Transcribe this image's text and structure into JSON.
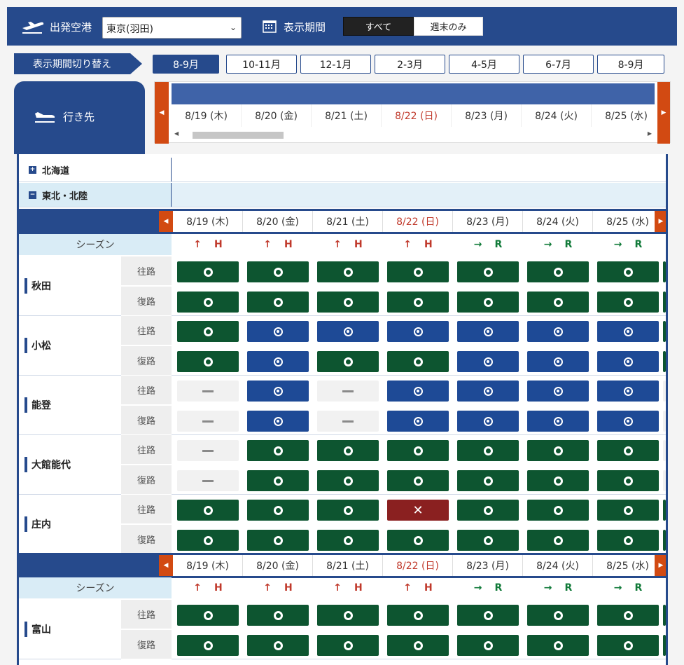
{
  "topbar": {
    "departure_label": "出発空港",
    "departure_value": "東京(羽田)",
    "period_label": "表示期間",
    "period_all": "すべて",
    "period_weekend": "週末のみ"
  },
  "period_switch": {
    "label": "表示期間切り替え",
    "tabs": [
      "8-9月",
      "10-11月",
      "12-1月",
      "2-3月",
      "4-5月",
      "6-7月",
      "8-9月"
    ],
    "active_index": 0
  },
  "destination_header": "行き先",
  "dates": [
    {
      "label": "8/19 (木)",
      "sun": false
    },
    {
      "label": "8/20 (金)",
      "sun": false
    },
    {
      "label": "8/21 (土)",
      "sun": false
    },
    {
      "label": "8/22 (日)",
      "sun": true
    },
    {
      "label": "8/23 (月)",
      "sun": false
    },
    {
      "label": "8/24 (火)",
      "sun": false
    },
    {
      "label": "8/25 (水)",
      "sun": false
    }
  ],
  "regions": [
    {
      "name": "北海道",
      "toggle": "+"
    },
    {
      "name": "東北・北陸",
      "toggle": "−"
    }
  ],
  "season_label": "シーズン",
  "season": [
    {
      "arrow": "↑",
      "letter": "H",
      "kind": "hi"
    },
    {
      "arrow": "↑",
      "letter": "H",
      "kind": "hi"
    },
    {
      "arrow": "↑",
      "letter": "H",
      "kind": "hi"
    },
    {
      "arrow": "↑",
      "letter": "H",
      "kind": "hi"
    },
    {
      "arrow": "→",
      "letter": "R",
      "kind": "reg"
    },
    {
      "arrow": "→",
      "letter": "R",
      "kind": "reg"
    },
    {
      "arrow": "→",
      "letter": "R",
      "kind": "reg"
    }
  ],
  "direction_out": "往路",
  "direction_return": "復路",
  "destinations_block1": [
    {
      "name": "秋田",
      "out": [
        "o",
        "o",
        "o",
        "o",
        "o",
        "o",
        "o"
      ],
      "ret": [
        "o",
        "o",
        "o",
        "o",
        "o",
        "o",
        "o"
      ],
      "out_c": [
        "g",
        "g",
        "g",
        "g",
        "g",
        "g",
        "g"
      ],
      "ret_c": [
        "g",
        "g",
        "g",
        "g",
        "g",
        "g",
        "g"
      ]
    },
    {
      "name": "小松",
      "out": [
        "o",
        "t",
        "t",
        "t",
        "t",
        "t",
        "t"
      ],
      "ret": [
        "o",
        "t",
        "o",
        "o",
        "t",
        "t",
        "t"
      ],
      "out_c": [
        "g",
        "b",
        "b",
        "b",
        "b",
        "b",
        "b"
      ],
      "ret_c": [
        "g",
        "b",
        "g",
        "g",
        "b",
        "b",
        "b"
      ]
    },
    {
      "name": "能登",
      "out": [
        "-",
        "t",
        "-",
        "t",
        "t",
        "t",
        "t"
      ],
      "ret": [
        "-",
        "t",
        "-",
        "t",
        "t",
        "t",
        "t"
      ],
      "out_c": [
        "n",
        "b",
        "n",
        "b",
        "b",
        "b",
        "b"
      ],
      "ret_c": [
        "n",
        "b",
        "n",
        "b",
        "b",
        "b",
        "b"
      ]
    },
    {
      "name": "大館能代",
      "out": [
        "-",
        "o",
        "o",
        "o",
        "o",
        "o",
        "o"
      ],
      "ret": [
        "-",
        "o",
        "o",
        "o",
        "o",
        "o",
        "o"
      ],
      "out_c": [
        "n",
        "g",
        "g",
        "g",
        "g",
        "g",
        "g"
      ],
      "ret_c": [
        "n",
        "g",
        "g",
        "g",
        "g",
        "g",
        "g"
      ]
    },
    {
      "name": "庄内",
      "out": [
        "o",
        "o",
        "o",
        "x",
        "o",
        "o",
        "o"
      ],
      "ret": [
        "o",
        "o",
        "o",
        "o",
        "o",
        "o",
        "o"
      ],
      "out_c": [
        "g",
        "g",
        "g",
        "r",
        "g",
        "g",
        "g"
      ],
      "ret_c": [
        "g",
        "g",
        "g",
        "g",
        "g",
        "g",
        "g"
      ]
    }
  ],
  "destinations_block2": [
    {
      "name": "富山",
      "out": [
        "o",
        "o",
        "o",
        "o",
        "o",
        "o",
        "o"
      ],
      "ret": [
        "o",
        "o",
        "o",
        "o",
        "o",
        "o",
        "o"
      ],
      "out_c": [
        "g",
        "g",
        "g",
        "g",
        "g",
        "g",
        "g"
      ],
      "ret_c": [
        "g",
        "g",
        "g",
        "g",
        "g",
        "g",
        "g"
      ]
    }
  ],
  "colors": {
    "navy": "#264a8c",
    "green": "#0d5530",
    "blue": "#1e4a96",
    "red": "#8a2020",
    "orange": "#d24a12"
  }
}
